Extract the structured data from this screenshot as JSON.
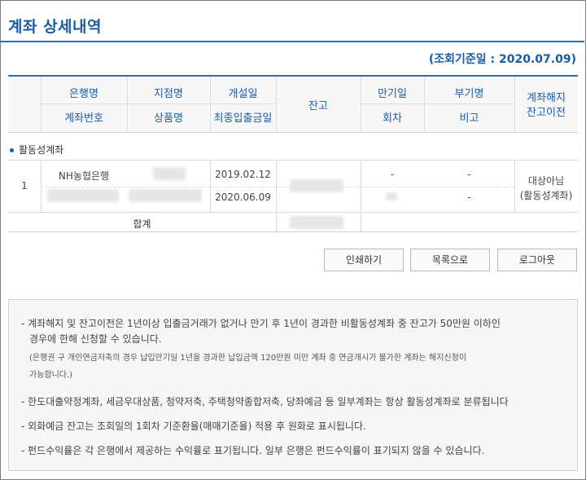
{
  "page": {
    "title": "계좌 상세내역",
    "reference_date": "(조회기준일 : 2020.07.09)"
  },
  "table": {
    "headers": {
      "bank": "은행명",
      "account_no": "계좌번호",
      "branch": "지점명",
      "product": "상품명",
      "opened": "개설일",
      "last_deposit": "최종입출금일",
      "balance": "잔고",
      "maturity": "만기일",
      "round": "회차",
      "subtype": "부기명",
      "remarks": "비고",
      "termination": "계좌해지",
      "transfer": "잔고이전"
    },
    "section_label": "활동성계좌",
    "rows": [
      {
        "no": "1",
        "bank": "NH농협은행",
        "opened": "2019.02.12",
        "last_deposit": "2020.06.09",
        "maturity": "-",
        "subtype": "-",
        "round": "",
        "remarks": "-",
        "status_line1": "대상아님",
        "status_line2": "(활동성계좌)"
      }
    ],
    "total_label": "합계"
  },
  "buttons": {
    "print": "인쇄하기",
    "list": "목록으로",
    "logout": "로그아웃"
  },
  "notes": {
    "n1_line1": "- 계좌해지 및 잔고이전은 1년이상 입출금거래가 없거나 만기 후 1년이 경과한 비활동성계좌 중 잔고가 50만원 이하인",
    "n1_line2": "경우에 한해 신청할 수 있습니다.",
    "n1_sub1": "(은행권 구 개인연금저축의 경우 납입만기일 1년을 경과한 납입금액 120만원 미만 계좌 중 연금개시가 불가한 계좌는 해지신청이",
    "n1_sub2": "가능합니다.)",
    "n2": "- 한도대출약정계좌, 세금우대상품, 청약저축, 주택청약종합저축, 당좌예금 등 일부계좌는 항상 활동성계좌로 분류됩니다",
    "n3": "- 외화예금 잔고는 조회일의 1회차 기준환율(매매기준율) 적용 후 원화로 표시됩니다.",
    "n4": "- 펀드수익률은 각 은행에서 제공하는 수익률로 표기됩니다. 일부 은행은 펀드수익률이 표기되지 않을 수 있습니다."
  },
  "colors": {
    "accent": "#1a5ba6",
    "rule": "#2a6fb8",
    "header_bg": "#f7f7f7",
    "notice_bg": "#f6f6f6"
  }
}
